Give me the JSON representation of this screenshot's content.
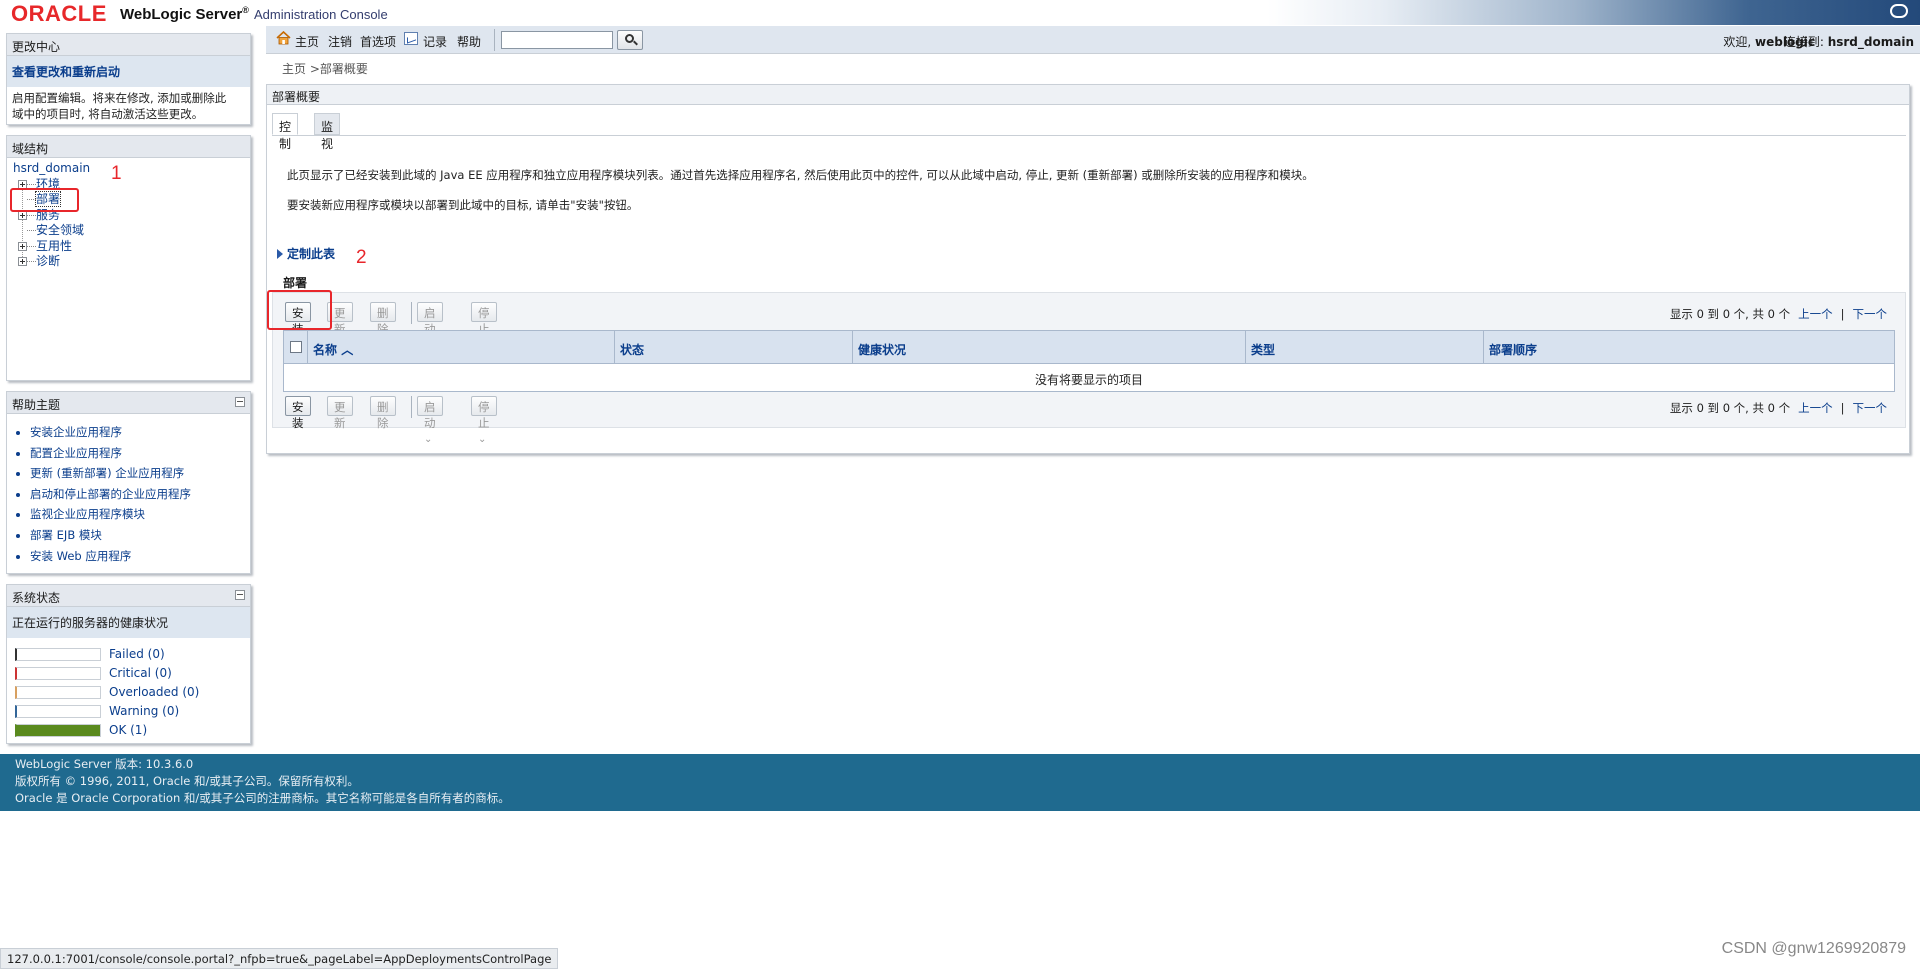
{
  "header": {
    "logo": "ORACLE",
    "product": "WebLogic Server",
    "product_mark": "®",
    "console": "Administration Console"
  },
  "change_center": {
    "title": "更改中心",
    "link": "查看更改和重新启动",
    "desc_line1": "启用配置编辑。将来在修改, 添加或删除此",
    "desc_line2": "域中的项目时, 将自动激活这些更改。"
  },
  "domain_structure": {
    "title": "域结构",
    "root": "hsrd_domain",
    "items": [
      {
        "label": "环境",
        "expandable": true
      },
      {
        "label": "部署",
        "expandable": false,
        "current": true
      },
      {
        "label": "服务",
        "expandable": true
      },
      {
        "label": "安全领域",
        "expandable": false
      },
      {
        "label": "互用性",
        "expandable": true
      },
      {
        "label": "诊断",
        "expandable": true
      }
    ]
  },
  "help_topics": {
    "title": "帮助主题",
    "links": [
      "安装企业应用程序",
      "配置企业应用程序",
      "更新 (重新部署) 企业应用程序",
      "启动和停止部署的企业应用程序",
      "监视企业应用程序模块",
      "部署 EJB 模块",
      "安装 Web 应用程序"
    ]
  },
  "system_status": {
    "title": "系统状态",
    "subtitle": "正在运行的服务器的健康状况",
    "rows": [
      {
        "label": "Failed (0)",
        "color": "#333333",
        "fill": 0
      },
      {
        "label": "Critical (0)",
        "color": "#cc3333",
        "fill": 0
      },
      {
        "label": "Overloaded (0)",
        "color": "#d8a060",
        "fill": 0
      },
      {
        "label": "Warning (0)",
        "color": "#336699",
        "fill": 0
      },
      {
        "label": "OK (1)",
        "color": "#5a8a1e",
        "fill": 1
      }
    ]
  },
  "toolbar": {
    "home": "主页",
    "logout": "注销",
    "preferences": "首选项",
    "record": "记录",
    "help": "帮助",
    "search_value": "",
    "welcome_prefix": "欢迎,",
    "welcome_user": "weblogic",
    "connected_prefix": "连接到:",
    "connected_domain": "hsrd_domain"
  },
  "breadcrumb": {
    "home": "主页",
    "sep": " >",
    "current": "部署概要"
  },
  "main": {
    "title": "部署概要",
    "tabs": [
      "控制",
      "监视"
    ],
    "intro1": "此页显示了已经安装到此域的 Java EE 应用程序和独立应用程序模块列表。通过首先选择应用程序名, 然后使用此页中的控件, 可以从此域中启动, 停止, 更新 (重新部署) 或删除所安装的应用程序和模块。",
    "intro2": "要安装新应用程序或模块以部署到此域中的目标, 请单击\"安装\"按钮。",
    "customize": "定制此表",
    "section": "部署"
  },
  "table": {
    "buttons": {
      "install": "安装",
      "update": "更新",
      "delete": "删除",
      "start": "启动",
      "stop": "停止"
    },
    "pager": {
      "summary": "显示 0 到 0 个, 共 0 个",
      "prev": "上一个",
      "sep": "|",
      "next": "下一个"
    },
    "columns": [
      "名称",
      "状态",
      "健康状况",
      "类型",
      "部署顺序"
    ],
    "empty": "没有将要显示的项目"
  },
  "annotations": {
    "num1": "1",
    "num2": "2"
  },
  "footer": {
    "line1": "WebLogic Server 版本: 10.3.6.0",
    "line2": "版权所有 © 1996, 2011, Oracle 和/或其子公司。保留所有权利。",
    "line3": "Oracle 是 Oracle Corporation 和/或其子公司的注册商标。其它名称可能是各自所有者的商标。"
  },
  "status_url": "127.0.0.1:7001/console/console.portal?_nfpb=true&_pageLabel=AppDeploymentsControlPage",
  "watermark": "CSDN @gnw1269920879"
}
